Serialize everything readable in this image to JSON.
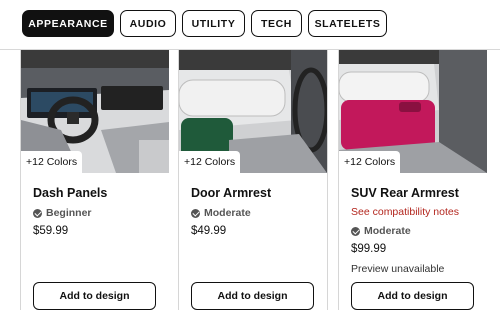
{
  "tabs": [
    {
      "label": "APPEARANCE",
      "active": true
    },
    {
      "label": "AUDIO",
      "active": false
    },
    {
      "label": "UTILITY",
      "active": false
    },
    {
      "label": "TECH",
      "active": false
    },
    {
      "label": "SLATELETS",
      "active": false
    }
  ],
  "products": [
    {
      "name": "Dash Panels",
      "colors": "+12 Colors",
      "difficulty": "Beginner",
      "difficulty_icon": "badge-icon",
      "price": "$59.99",
      "button": "Add to design",
      "accent_color": "#2a2a2a"
    },
    {
      "name": "Door Armrest",
      "colors": "+12 Colors",
      "difficulty": "Moderate",
      "difficulty_icon": "badge-icon",
      "price": "$49.99",
      "button": "Add to design",
      "accent_color": "#1f5a3a"
    },
    {
      "name": "SUV Rear Armrest",
      "colors": "+12 Colors",
      "compatibility": "See compatibility notes",
      "difficulty": "Moderate",
      "difficulty_icon": "badge-icon",
      "price": "$99.99",
      "availability": "Preview unavailable",
      "button": "Add to design",
      "accent_color": "#c2185b"
    }
  ],
  "colors": {
    "active_tab_bg": "#111111",
    "warning_text": "#b3261e"
  }
}
